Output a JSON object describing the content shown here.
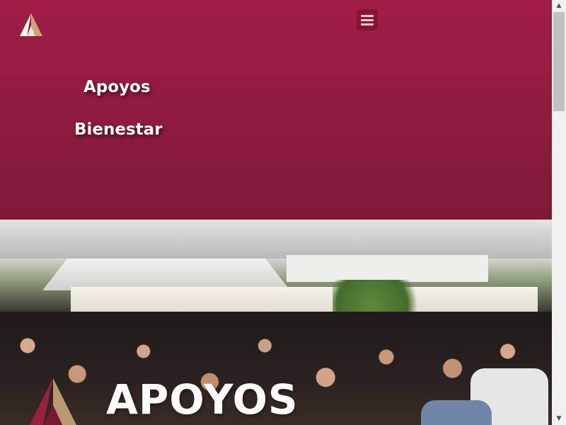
{
  "header": {
    "logo_icon": "a-logo-icon",
    "menu_icon": "hamburger-menu-icon",
    "nav": [
      {
        "label": "Apoyos"
      },
      {
        "label": "Bienestar"
      }
    ],
    "colors": {
      "top": "#a21d45",
      "bottom": "#7e1a36",
      "menu_bars": "#e8d5c2"
    }
  },
  "hero": {
    "title": "APOYOS",
    "logo_icon": "a-logo-icon"
  },
  "scrollbar": {
    "up_icon": "scroll-up-arrow-icon",
    "down_icon": "scroll-down-arrow-icon",
    "up_glyph": "▲",
    "down_glyph": "▼"
  }
}
